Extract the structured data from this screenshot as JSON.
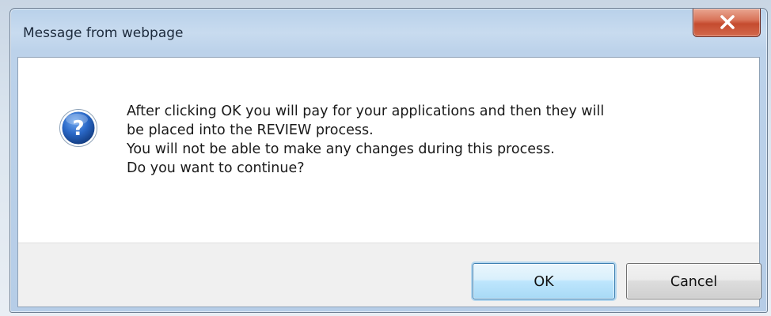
{
  "dialog": {
    "title": "Message from webpage",
    "close_icon": "close-x-icon",
    "icon": "question-mark-icon",
    "message_lines": [
      "After clicking OK you will pay for your applications and then they will",
      "be placed into the REVIEW process.",
      "You will not be able to make any changes during this process.",
      "Do you want to continue?"
    ],
    "buttons": {
      "ok_label": "OK",
      "cancel_label": "Cancel"
    }
  },
  "colors": {
    "close_button": "#c54b2f",
    "question_icon": "#1f5fb8",
    "ok_focus_border": "#3c7fb1"
  }
}
